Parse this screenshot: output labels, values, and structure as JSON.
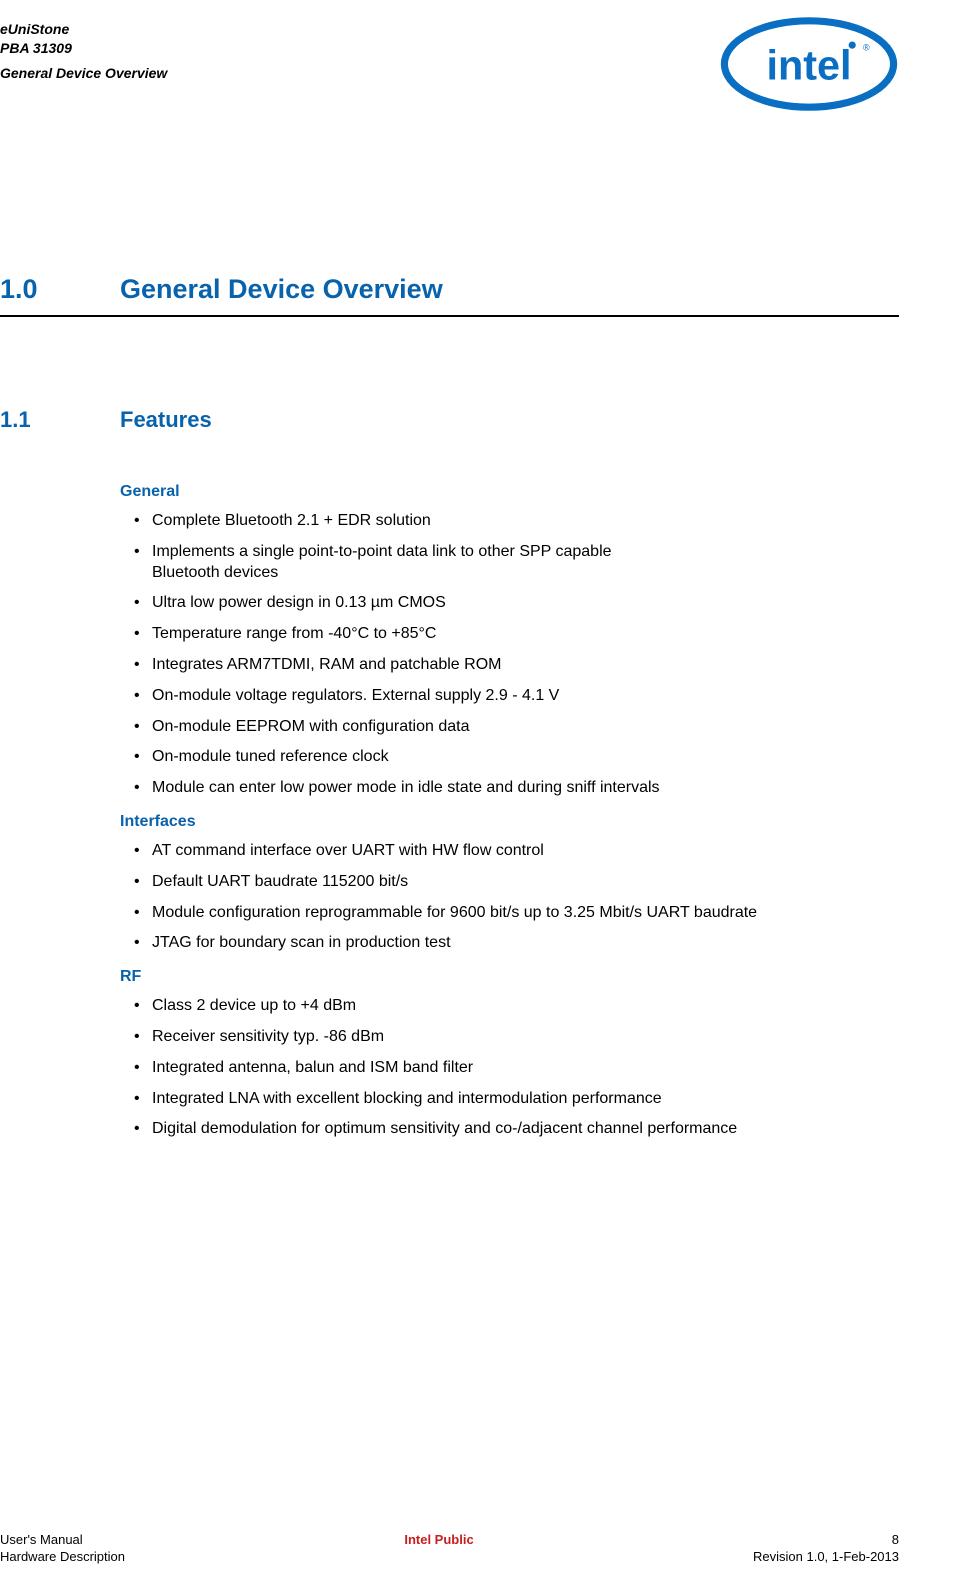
{
  "header": {
    "line1": "eUniStone",
    "line2": "PBA 31309",
    "subtitle": "General Device Overview",
    "logo_text": "intel"
  },
  "chapter": {
    "number": "1.0",
    "title": "General Device Overview"
  },
  "section": {
    "number": "1.1",
    "title": "Features"
  },
  "groups": [
    {
      "heading": "General",
      "items": [
        "Complete Bluetooth 2.1 + EDR solution",
        "Implements a single point-to-point data link to other SPP capable Bluetooth devices",
        "Ultra low power design in 0.13 µm CMOS",
        "Temperature range from -40°C to +85°C",
        "Integrates ARM7TDMI, RAM and patchable ROM",
        "On-module voltage regulators. External supply 2.9 - 4.1 V",
        "On-module EEPROM with configuration data",
        "On-module tuned reference clock",
        "Module can enter low power mode in idle state and during sniff intervals"
      ]
    },
    {
      "heading": "Interfaces",
      "items": [
        "AT command interface over UART with HW flow control",
        "Default UART baudrate 115200 bit/s",
        "Module configuration reprogrammable for 9600 bit/s up to 3.25 Mbit/s UART baudrate",
        "JTAG for boundary scan in production test"
      ]
    },
    {
      "heading": "RF",
      "items": [
        "Class 2 device up to +4 dBm",
        "Receiver sensitivity typ. -86 dBm",
        "Integrated antenna, balun and ISM band filter",
        "Integrated LNA with excellent blocking and intermodulation performance",
        "Digital demodulation for optimum sensitivity and co-/adjacent channel performance"
      ]
    }
  ],
  "footer": {
    "left_line1": "User's Manual",
    "left_line2": "Hardware Description",
    "center": "Intel Public",
    "right_line1": "8",
    "right_line2": "Revision 1.0, 1-Feb-2013"
  }
}
